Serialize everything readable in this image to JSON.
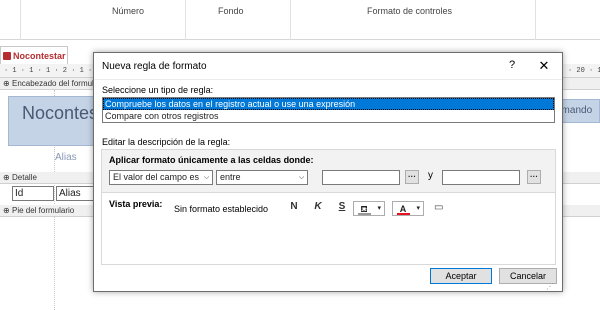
{
  "ribbon": {
    "numero_label": "Número",
    "fondo_label": "Fondo",
    "formato_label": "Formato de controles"
  },
  "document": {
    "tab_label": "Nocontestar",
    "ruler_left": "· 1 · 1 · 1 · 2 · 1 · 3",
    "ruler_right": "· 20 · 1",
    "header_section": "Encabezado del formulario",
    "header_title": "Nocontestar",
    "alias_label": "Alias",
    "detail_section": "Detalle",
    "field_id": "Id",
    "field_alias": "Alias",
    "footer_section": "Pie del formulario",
    "right_partial": "omando"
  },
  "dialog": {
    "title": "Nueva regla de formato",
    "help": "?",
    "close": "✕",
    "select_type_label": "Seleccione un tipo de regla:",
    "rule_types": [
      "Compruebe los datos en el registro actual o use una expresión",
      "Compare con otros registros"
    ],
    "selected_rule_index": 0,
    "edit_description_label": "Editar la descripción de la regla:",
    "apply_label": "Aplicar formato únicamente a las celdas donde:",
    "condition_field": "El valor del campo es",
    "condition_operator": "entre",
    "value1": "",
    "value2": "",
    "and_label": "y",
    "preview_label": "Vista previa:",
    "preview_text": "Sin formato establecido",
    "bold": "N",
    "italic": "K",
    "underline": "S",
    "ok_button": "Aceptar",
    "cancel_button": "Cancelar"
  },
  "colors": {
    "selection": "#0078d7",
    "tab_accent": "#b52e31",
    "header_band": "#c4d3e6",
    "fill_swatch": "#ffffff",
    "font_swatch": "#e81123"
  },
  "icons": {
    "fill_color": "paint-bucket-icon",
    "font_color": "font-color-icon",
    "conditional": "conditional-format-icon"
  }
}
